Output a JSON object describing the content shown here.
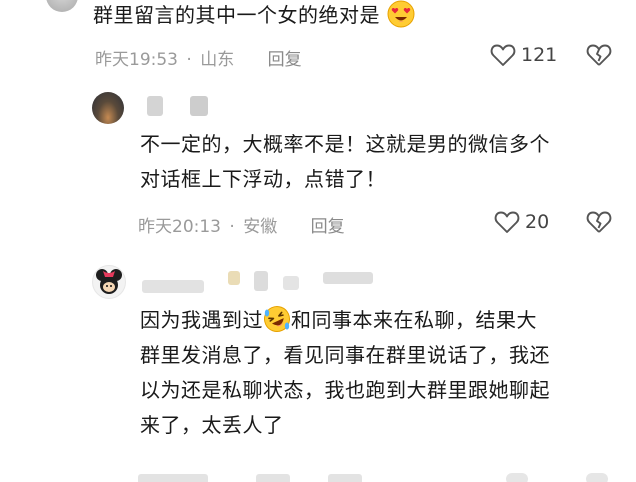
{
  "comments": [
    {
      "text": "群里留言的其中一个女的绝对是",
      "emoji": "heart-eyes-emoji",
      "time": "昨天19:53",
      "location": "山东",
      "reply": "回复",
      "likes": "121"
    },
    {
      "text_line1": "不一定的，大概率不是！这就是男的微信多个",
      "text_line2": "对话框上下浮动，点错了！",
      "time": "昨天20:13",
      "location": "安徽",
      "reply": "回复",
      "likes": "20"
    },
    {
      "line1_a": "因为我遇到过",
      "emoji": "rofl-emoji",
      "line1_b": "和同事本来在私聊，结果大",
      "line2": "群里发消息了，看见同事在群里说话了，我还",
      "line3": "以为还是私聊状态，我也跑到大群里跟她聊起",
      "line4": "来了，太丢人了"
    }
  ],
  "separator": "·",
  "colors": {
    "text": "#1a1a1a",
    "meta": "#9a9a9a",
    "icon": "#555555"
  }
}
